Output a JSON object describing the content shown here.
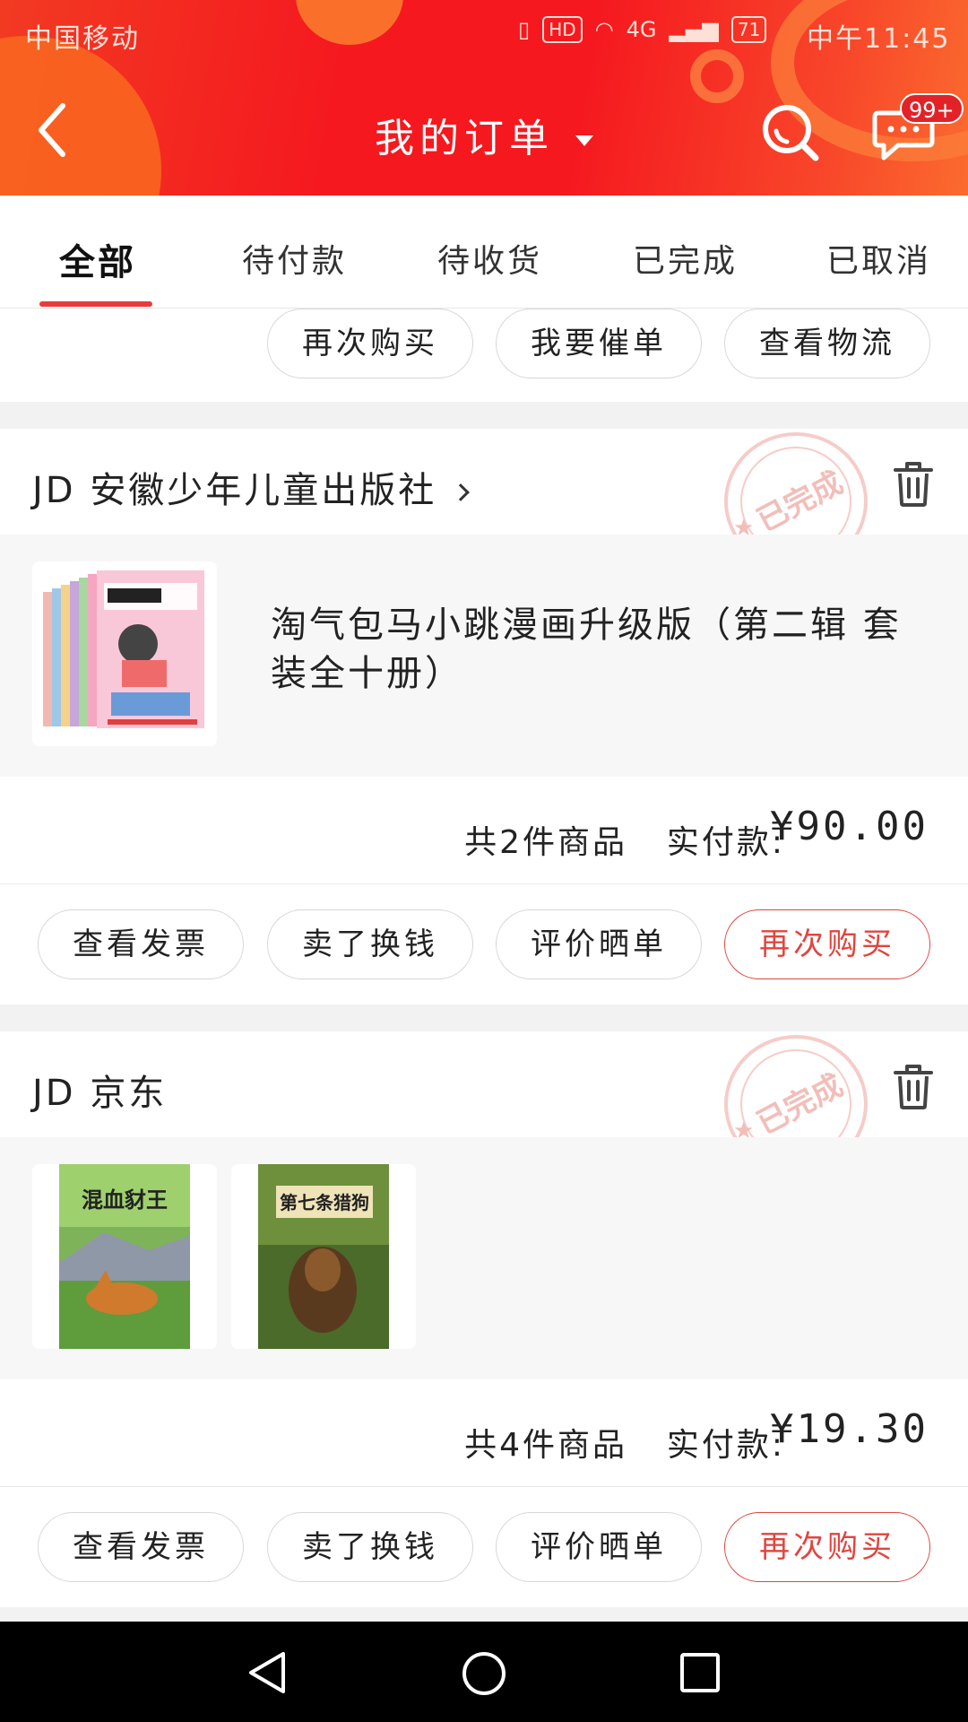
{
  "status_bar": {
    "carrier": "中国移动",
    "network": "4G",
    "hd": "HD",
    "battery": "71",
    "time": "中午11:45"
  },
  "nav": {
    "title": "我的订单",
    "message_badge": "99+"
  },
  "tabs": [
    {
      "label": "全部",
      "active": true
    },
    {
      "label": "待付款",
      "active": false
    },
    {
      "label": "待收货",
      "active": false
    },
    {
      "label": "已完成",
      "active": false
    },
    {
      "label": "已取消",
      "active": false
    }
  ],
  "top_partial_card": {
    "buttons": [
      "再次购买",
      "我要催单",
      "查看物流"
    ]
  },
  "orders": [
    {
      "shop": "JD 安徽少年儿童出版社",
      "status_stamp": "已完成",
      "product_title": "淘气包马小跳漫画升级版（第二辑 套装全十册）",
      "count_text": "共2件商品",
      "paid_label": "实付款:",
      "amount": "¥90.00",
      "buttons": [
        "查看发票",
        "卖了换钱",
        "评价晒单",
        "再次购买"
      ]
    },
    {
      "shop": "JD 京东",
      "status_stamp": "已完成",
      "books": [
        {
          "cover_title": "混血豺王"
        },
        {
          "cover_title": "第七条猎狗"
        }
      ],
      "count_text": "共4件商品",
      "paid_label": "实付款:",
      "amount": "¥19.30",
      "buttons": [
        "查看发票",
        "卖了换钱",
        "评价晒单",
        "再次购买"
      ]
    }
  ],
  "colors": {
    "brand_red": "#f5191f",
    "accent_red": "#e0453f",
    "tab_indicator": "#e93b3d"
  }
}
